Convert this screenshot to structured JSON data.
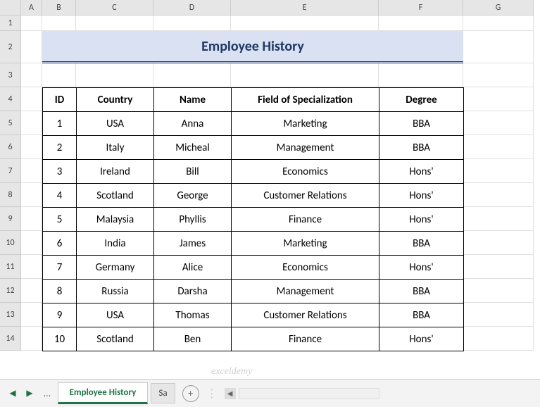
{
  "columns": [
    "A",
    "B",
    "C",
    "D",
    "E",
    "F",
    "G"
  ],
  "rows": [
    "1",
    "2",
    "3",
    "4",
    "5",
    "6",
    "7",
    "8",
    "9",
    "10",
    "11",
    "12",
    "13",
    "14"
  ],
  "title": "Employee History",
  "headers": {
    "id": "ID",
    "country": "Country",
    "name": "Name",
    "field": "Field of Specialization",
    "degree": "Degree"
  },
  "data": [
    {
      "id": "1",
      "country": "USA",
      "name": "Anna",
      "field": "Marketing",
      "degree": "BBA"
    },
    {
      "id": "2",
      "country": "Italy",
      "name": "Micheal",
      "field": "Management",
      "degree": "BBA"
    },
    {
      "id": "3",
      "country": "Ireland",
      "name": "Bill",
      "field": "Economics",
      "degree": "Hons'"
    },
    {
      "id": "4",
      "country": "Scotland",
      "name": "George",
      "field": "Customer Relations",
      "degree": "Hons'"
    },
    {
      "id": "5",
      "country": "Malaysia",
      "name": "Phyllis",
      "field": "Finance",
      "degree": "Hons'"
    },
    {
      "id": "6",
      "country": "India",
      "name": "James",
      "field": "Marketing",
      "degree": "BBA"
    },
    {
      "id": "7",
      "country": "Germany",
      "name": "Alice",
      "field": "Economics",
      "degree": "Hons'"
    },
    {
      "id": "8",
      "country": "Russia",
      "name": "Darsha",
      "field": "Management",
      "degree": "BBA"
    },
    {
      "id": "9",
      "country": "USA",
      "name": "Thomas",
      "field": "Customer Relations",
      "degree": "BBA"
    },
    {
      "id": "10",
      "country": "Scotland",
      "name": "Ben",
      "field": "Finance",
      "degree": "Hons'"
    }
  ],
  "tabs": {
    "active": "Employee History",
    "next": "Sa"
  },
  "watermark": "exceldemy",
  "chart_data": {
    "type": "table",
    "title": "Employee History",
    "columns": [
      "ID",
      "Country",
      "Name",
      "Field of Specialization",
      "Degree"
    ],
    "rows": [
      [
        1,
        "USA",
        "Anna",
        "Marketing",
        "BBA"
      ],
      [
        2,
        "Italy",
        "Micheal",
        "Management",
        "BBA"
      ],
      [
        3,
        "Ireland",
        "Bill",
        "Economics",
        "Hons'"
      ],
      [
        4,
        "Scotland",
        "George",
        "Customer Relations",
        "Hons'"
      ],
      [
        5,
        "Malaysia",
        "Phyllis",
        "Finance",
        "Hons'"
      ],
      [
        6,
        "India",
        "James",
        "Marketing",
        "BBA"
      ],
      [
        7,
        "Germany",
        "Alice",
        "Economics",
        "Hons'"
      ],
      [
        8,
        "Russia",
        "Darsha",
        "Management",
        "BBA"
      ],
      [
        9,
        "USA",
        "Thomas",
        "Customer Relations",
        "BBA"
      ],
      [
        10,
        "Scotland",
        "Ben",
        "Finance",
        "Hons'"
      ]
    ]
  }
}
